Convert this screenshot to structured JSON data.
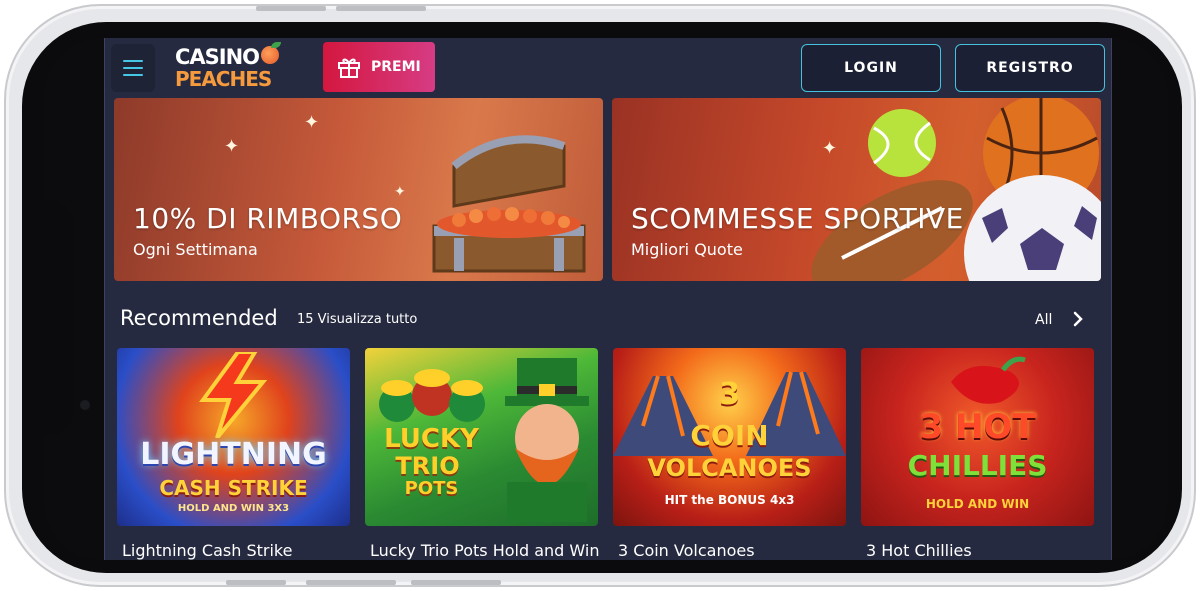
{
  "header": {
    "logo_line1": "CASINO",
    "logo_line2": "PEACHES",
    "premi_label": "PREMI",
    "login_label": "LOGIN",
    "register_label": "REGISTRO"
  },
  "banners": [
    {
      "title": "10% DI RIMBORSO",
      "subtitle": "Ogni Settimana"
    },
    {
      "title": "SCOMMESSE SPORTIVE",
      "subtitle": "Migliori Quote"
    }
  ],
  "recommended": {
    "title": "Recommended",
    "count_label": "15 Visualizza tutto",
    "all_label": "All",
    "games": [
      {
        "name": "Lightning Cash Strike",
        "art_line1": "LIGHTNING",
        "art_line2": "CASH STRIKE",
        "art_line3": "HOLD AND WIN 3X3"
      },
      {
        "name": "Lucky Trio Pots Hold and Win",
        "art_line1": "LUCKY",
        "art_line2": "TRIO",
        "art_line3": "POTS"
      },
      {
        "name": "3 Coin Volcanoes",
        "art_line1": "3",
        "art_line2": "COIN",
        "art_line3": "VOLCANOES",
        "art_line4": "HIT the BONUS 4x3"
      },
      {
        "name": "3 Hot Chillies",
        "art_line1": "3 HOT",
        "art_line2": "CHILLIES",
        "art_line3": "HOLD AND WIN"
      }
    ]
  },
  "colors": {
    "app_background": "#262a40",
    "accent_cyan": "#46c2dc",
    "premi_gradient_start": "#d4173f",
    "premi_gradient_end": "#d63c84",
    "logo_orange": "#f59a3d"
  }
}
